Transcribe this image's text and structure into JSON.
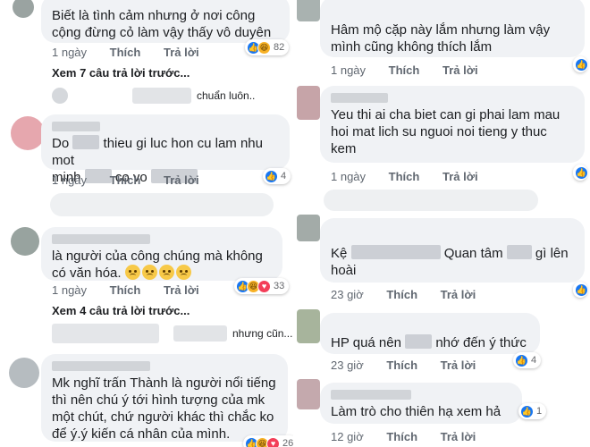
{
  "left": {
    "c1": {
      "text": "Biết là tình cảm nhưng ở nơi công cộng đừng cỏ làm vậy thấy vô duyên",
      "time": "1 ngày",
      "like": "Thích",
      "reply": "Trả lời",
      "reaction_count": "82"
    },
    "more1": "Xem 7 câu trả lời trước...",
    "mini1": "chuẩn luôn..",
    "c2": {
      "t1": "Do",
      "t2": "thieu gi luc hon cu lam nhu mot",
      "t3": "minh",
      "t4": "co vo",
      "time": "1 ngày",
      "like": "Thích",
      "reply": "Trả lời",
      "reaction_count": "4"
    },
    "c3": {
      "text": "là người của công chúng mà không có văn hóa.",
      "time": "1 ngày",
      "like": "Thích",
      "reply": "Trả lời",
      "reaction_count": "33"
    },
    "more2": "Xem 4 câu trả lời trước...",
    "mini2": "nhưng cũn...",
    "c4": {
      "text": "Mk nghĩ trấn Thành là người nổi tiếng thì nên chú ý tới hình tượng của mk một chút, chứ người khác thì chắc ko để ý.ý kiến cá nhân của mình.",
      "reaction_count": "26"
    }
  },
  "right": {
    "r1": {
      "text": "Hâm mộ cặp này lắm nhưng làm vậy mình cũng không thích lắm",
      "time": "1 ngày",
      "like": "Thích",
      "reply": "Trả lời"
    },
    "r2": {
      "text": "Yeu thi ai cha biet can gi phai lam mau hoi mat lich su nguoi noi tieng y thuc kem",
      "time": "1 ngày",
      "like": "Thích",
      "reply": "Trả lời"
    },
    "r3": {
      "t1": "Kệ",
      "t2": "Quan tâm",
      "t3": "gì lên",
      "t4": "hoài",
      "time": "23 giờ",
      "like": "Thích",
      "reply": "Trả lời"
    },
    "r4": {
      "t1": "HP quá nên",
      "t2": "nhớ đến ý thức",
      "time": "23 giờ",
      "like": "Thích",
      "reply": "Trả lời",
      "reaction_count": "4"
    },
    "r5": {
      "text": "Làm trò cho thiên hạ xem hả",
      "time": "12 giờ",
      "like": "Thích",
      "reply": "Trả lời",
      "reaction_count": "1"
    }
  },
  "colors": {
    "bubble": "#f0f2f5",
    "like_blue": "#1877f2",
    "meta_gray": "#606770"
  },
  "icons": [
    "like-reaction-icon",
    "haha-reaction-icon",
    "love-reaction-icon",
    "sad-emoji-icon"
  ]
}
